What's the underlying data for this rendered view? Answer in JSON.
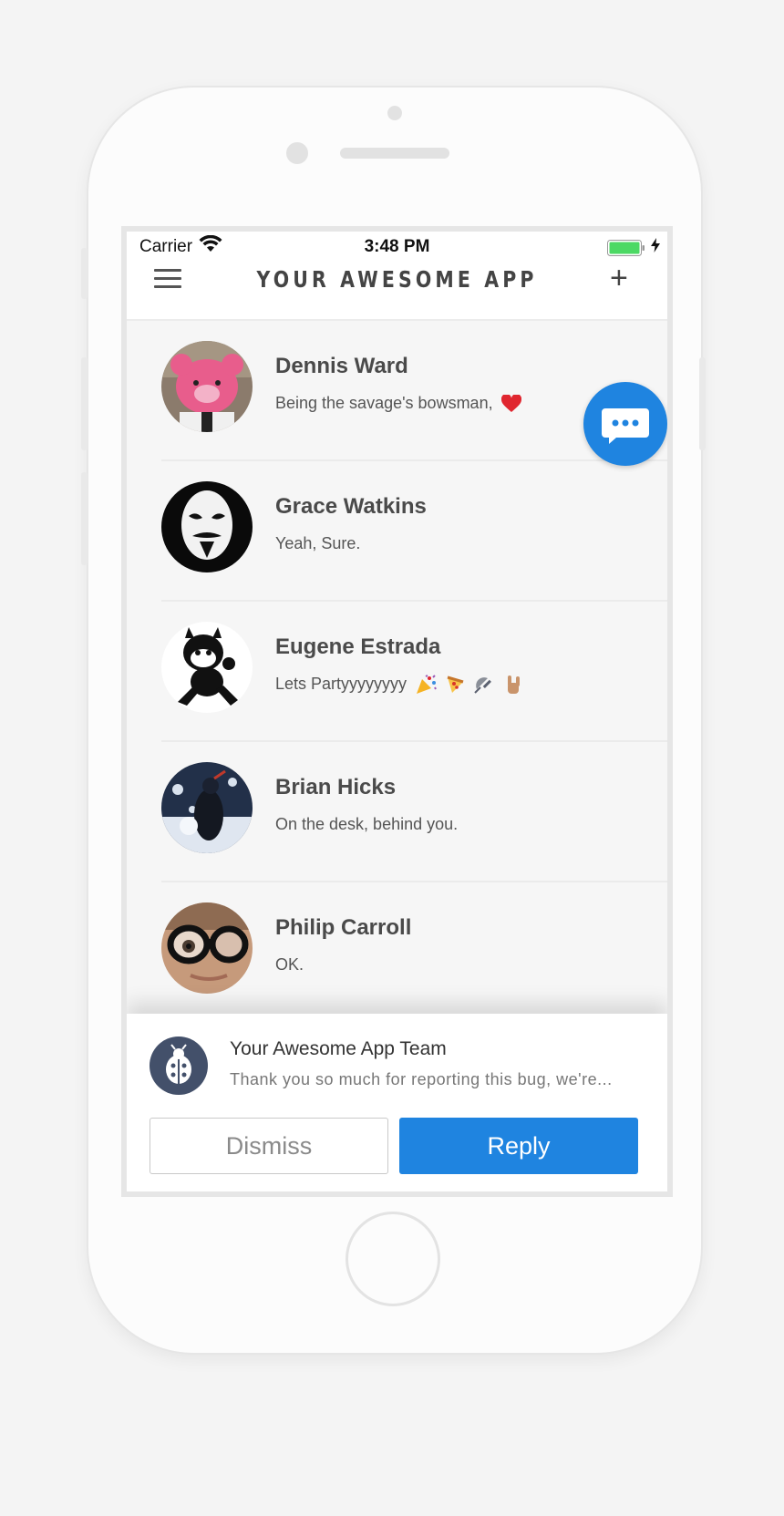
{
  "status_bar": {
    "carrier": "Carrier",
    "time": "3:48 PM"
  },
  "nav": {
    "title": "YOUR AWESOME APP"
  },
  "conversations": [
    {
      "name": "Dennis Ward",
      "preview": "Being the savage's bowsman,",
      "emoji": [
        "heart"
      ]
    },
    {
      "name": "Grace Watkins",
      "preview": "Yeah, Sure.",
      "emoji": []
    },
    {
      "name": "Eugene Estrada",
      "preview": "Lets Partyyyyyyyy",
      "emoji": [
        "party-popper",
        "pizza",
        "satellite",
        "rock-hand"
      ]
    },
    {
      "name": "Brian Hicks",
      "preview": "On the desk, behind you.",
      "emoji": []
    },
    {
      "name": "Philip Carroll",
      "preview": "OK.",
      "emoji": []
    }
  ],
  "notification": {
    "sender": "Your Awesome App Team",
    "message": "Thank you so much for reporting this bug, we're...",
    "dismiss_label": "Dismiss",
    "reply_label": "Reply"
  },
  "colors": {
    "accent": "#1f84e0",
    "battery": "#4cd964",
    "notif_icon_bg": "#43506a"
  },
  "icons": [
    "wifi-icon",
    "battery-icon",
    "charging-bolt-icon",
    "menu-icon",
    "plus-icon",
    "chat-bubble-icon",
    "ladybug-icon"
  ]
}
